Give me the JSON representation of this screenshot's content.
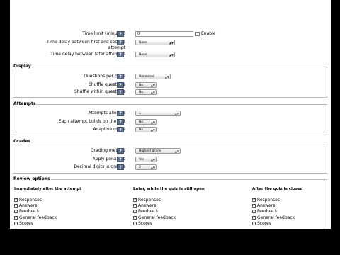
{
  "timing": {
    "time_limit": {
      "label": "Time limit (minutes)",
      "value": "0",
      "enable_label": "Enable"
    },
    "delay_first_second": {
      "label_line1": "Time delay between first and second",
      "label_line2": "attempt",
      "value": "None"
    },
    "delay_later": {
      "label": "Time delay between later attempts",
      "value": "None"
    }
  },
  "display": {
    "legend": "Display",
    "questions_per_page": {
      "label": "Questions per page",
      "value": "Unlimited"
    },
    "shuffle_questions": {
      "label": "Shuffle questions",
      "value": "No"
    },
    "shuffle_within": {
      "label": "Shuffle within questions",
      "value": "No"
    }
  },
  "attempts": {
    "legend": "Attempts",
    "allowed": {
      "label": "Attempts allowed",
      "value": "1"
    },
    "builds_on_last": {
      "label": "Each attempt builds on the last",
      "value": "No"
    },
    "adaptive": {
      "label": "Adaptive mode",
      "value": "No"
    }
  },
  "grades": {
    "legend": "Grades",
    "method": {
      "label": "Grading method",
      "value": "Highest grade"
    },
    "penalties": {
      "label": "Apply penalties",
      "value": "Yes"
    },
    "decimal": {
      "label": "Decimal digits in grades",
      "value": "2"
    }
  },
  "review": {
    "legend": "Review options",
    "columns": [
      {
        "heading": "Immediately after the attempt",
        "options": [
          "Responses",
          "Answers",
          "Feedback",
          "General feedback",
          "Scores"
        ]
      },
      {
        "heading": "Later, while the quiz is still open",
        "options": [
          "Responses",
          "Answers",
          "Feedback",
          "General feedback",
          "Scores"
        ]
      },
      {
        "heading": "After the quiz is closed",
        "options": [
          "Responses",
          "Answers",
          "Feedback",
          "General feedback",
          "Scores"
        ]
      }
    ]
  },
  "help_symbol": "?",
  "dropdown_arrow": "▲▼",
  "colors": {
    "help_button": "#5a6e8c",
    "fieldset_border": "#b8b8b8",
    "letterbox": "#000000"
  }
}
